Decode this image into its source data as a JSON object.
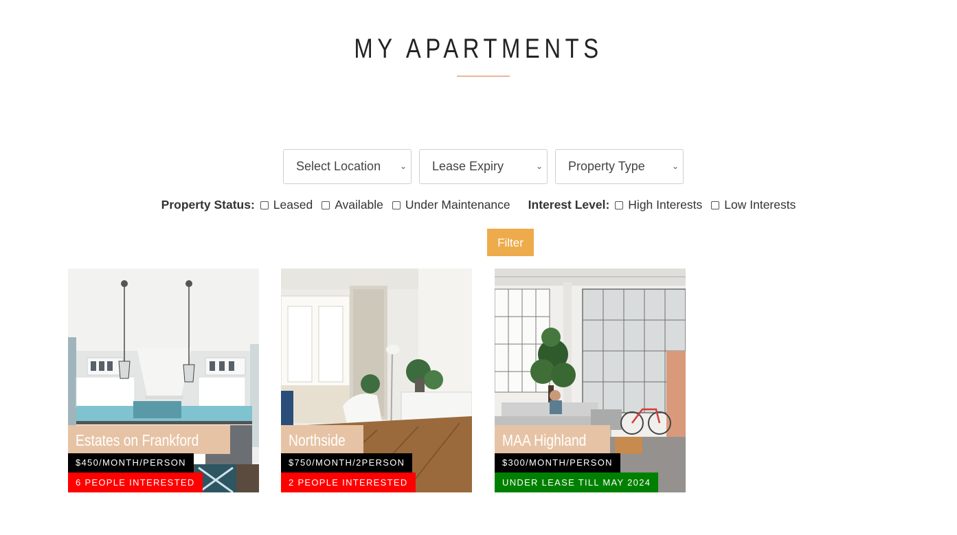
{
  "page": {
    "title": "MY APARTMENTS",
    "accent_color": "#e8b796"
  },
  "filters": {
    "selects": [
      {
        "value": "Select Location"
      },
      {
        "value": "Lease Expiry"
      },
      {
        "value": "Property Type"
      }
    ],
    "property_status": {
      "label": "Property Status:",
      "options": [
        "Leased",
        "Available",
        "Under Maintenance"
      ]
    },
    "interest_level": {
      "label": "Interest Level:",
      "options": [
        "High Interests",
        "Low Interests"
      ]
    },
    "filter_button": "Filter",
    "button_color": "#edab4b"
  },
  "apartments": [
    {
      "name": "Estates on Frankford",
      "price": "$450/MONTH/PERSON",
      "tag": "6 PEOPLE INTERESTED",
      "tag_color": "#ff0000",
      "photo": "kitchen"
    },
    {
      "name": "Northside",
      "price": "$750/MONTH/2PERSON",
      "tag": "2 PEOPLE INTERESTED",
      "tag_color": "#ff0000",
      "photo": "living-room-chair"
    },
    {
      "name": "MAA Highland",
      "price": "$300/MONTH/PERSON",
      "tag": "UNDER LEASE TILL MAY 2024",
      "tag_color": "#008000",
      "photo": "loft-with-bicycle"
    }
  ]
}
